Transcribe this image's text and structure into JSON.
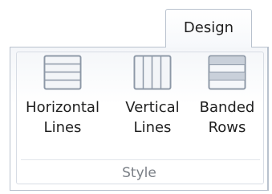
{
  "ribbon": {
    "tab_label": "Design",
    "group_caption": "Style",
    "buttons": [
      {
        "label": "Horizontal\nLines",
        "icon": "horizontal-lines-icon"
      },
      {
        "label": "Vertical\nLines",
        "icon": "vertical-lines-icon"
      },
      {
        "label": "Banded\nRows",
        "icon": "banded-rows-icon"
      }
    ]
  },
  "colors": {
    "border": "#b9c2ce",
    "icon_border": "#8d98a7",
    "icon_band": "#c9d0da",
    "text": "#1f1f1f",
    "caption": "#7a7f86"
  }
}
